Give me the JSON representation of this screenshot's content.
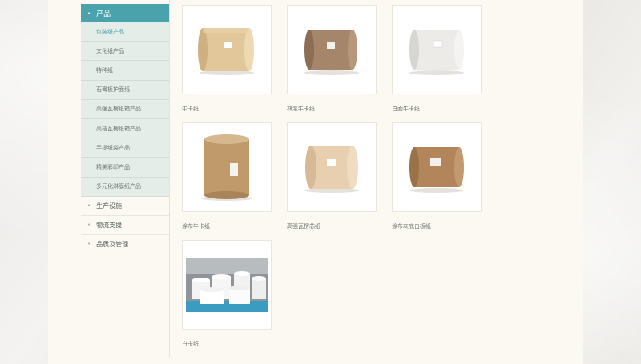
{
  "sidebar": {
    "header": "产品",
    "sub_items": [
      {
        "label": "包装纸产品",
        "active": true
      },
      {
        "label": "文化纸产品",
        "active": false
      },
      {
        "label": "特种纸",
        "active": false
      },
      {
        "label": "石膏板护面纸",
        "active": false
      },
      {
        "label": "高强瓦楞纸箱产品",
        "active": false
      },
      {
        "label": "高档瓦楞纸箱产品",
        "active": false
      },
      {
        "label": "手提纸袋产品",
        "active": false
      },
      {
        "label": "精美彩印产品",
        "active": false
      },
      {
        "label": "多元化淋膜纸产品",
        "active": false
      }
    ],
    "main_items": [
      {
        "label": "生产设施"
      },
      {
        "label": "物流支援"
      },
      {
        "label": "品质及管理"
      }
    ]
  },
  "products": [
    {
      "caption": "牛卡纸"
    },
    {
      "caption": "林浆牛卡纸"
    },
    {
      "caption": "白面牛卡纸"
    },
    {
      "caption": "涂布牛卡纸"
    },
    {
      "caption": "高强瓦楞芯纸"
    },
    {
      "caption": "涂布灰底白板纸"
    },
    {
      "caption": "白卡纸"
    }
  ],
  "colors": {
    "accent": "#4aa2ac",
    "roll_colors": [
      "#e2c79b",
      "#a6866a",
      "#ecebe8",
      "#c09a6b",
      "#e8cfaf",
      "#b2865a"
    ]
  },
  "icons": {
    "bullet": "bullet-dot-icon"
  }
}
